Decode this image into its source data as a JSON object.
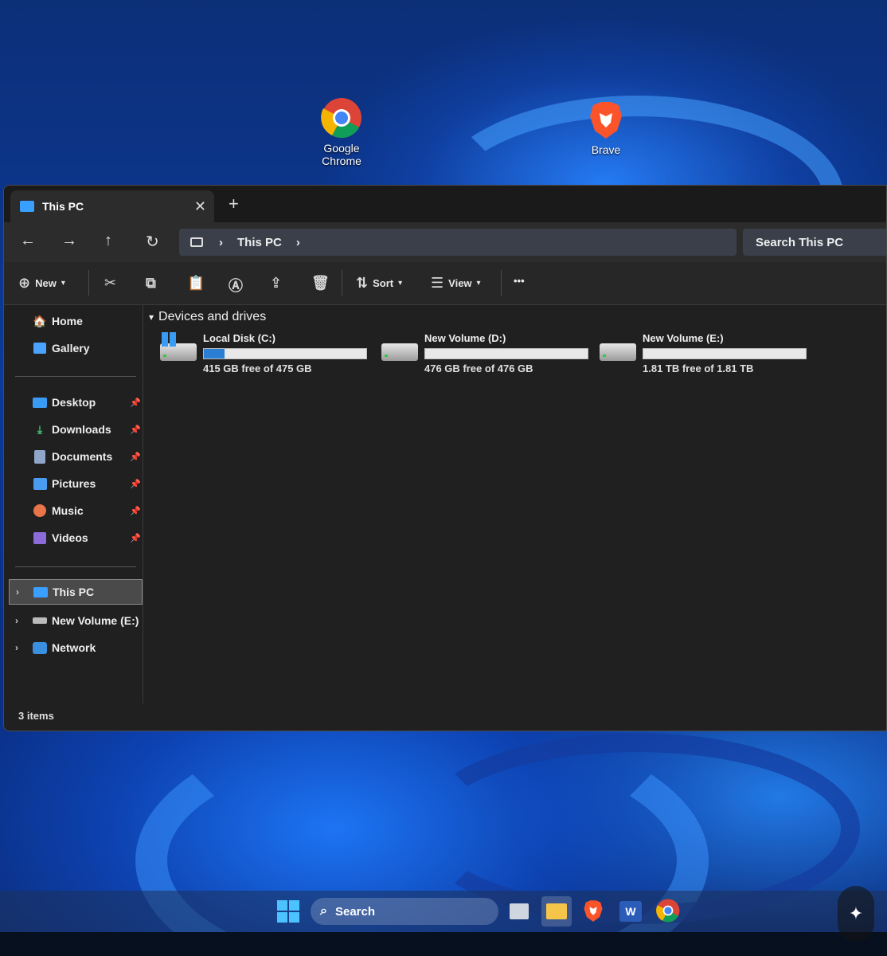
{
  "desktop": {
    "icons": [
      {
        "label": "Google Chrome",
        "icon": "chrome-icon"
      },
      {
        "label": "Brave",
        "icon": "brave-icon"
      }
    ]
  },
  "window": {
    "tab_title": "This PC",
    "tab_close": "✕",
    "new_tab": "+",
    "nav": {
      "back": "←",
      "forward": "→",
      "up": "↑",
      "refresh": "↻"
    },
    "breadcrumb": {
      "location": "This PC",
      "sep": "›"
    },
    "search_placeholder": "Search This PC",
    "toolbar": {
      "new_label": "New",
      "sort_label": "Sort",
      "view_label": "View",
      "more_label": "•••"
    },
    "sidebar": {
      "quick": [
        {
          "label": "Home",
          "icon": "home-icon"
        },
        {
          "label": "Gallery",
          "icon": "gallery-icon"
        }
      ],
      "pinned": [
        {
          "label": "Desktop",
          "icon": "desktop-folder-icon"
        },
        {
          "label": "Downloads",
          "icon": "downloads-icon"
        },
        {
          "label": "Documents",
          "icon": "documents-icon"
        },
        {
          "label": "Pictures",
          "icon": "pictures-icon"
        },
        {
          "label": "Music",
          "icon": "music-icon"
        },
        {
          "label": "Videos",
          "icon": "videos-icon"
        }
      ],
      "tree": [
        {
          "label": "This PC",
          "icon": "this-pc-icon",
          "selected": true
        },
        {
          "label": "New Volume (E:)",
          "icon": "drive-icon"
        },
        {
          "label": "Network",
          "icon": "network-icon"
        }
      ]
    },
    "content": {
      "group_title": "Devices and drives",
      "drives": [
        {
          "name": "Local Disk (C:)",
          "free_text": "415 GB free of 475 GB",
          "used_fraction": 0.126,
          "bar_color": "#2a7fd4"
        },
        {
          "name": "New Volume (D:)",
          "free_text": "476 GB free of 476 GB",
          "used_fraction": 0.0,
          "bar_color": "#2a7fd4"
        },
        {
          "name": "New Volume (E:)",
          "free_text": "1.81 TB free of 1.81 TB",
          "used_fraction": 0.0,
          "bar_color": "#2a7fd4"
        }
      ]
    },
    "status": {
      "items": "3 items"
    }
  },
  "taskbar": {
    "search_label": "Search",
    "apps": [
      "start-icon",
      "task-view-icon",
      "file-explorer-icon",
      "brave-icon",
      "word-icon",
      "chrome-icon"
    ]
  },
  "colors": {
    "accent": "#2a7fd4",
    "window_bg": "#202020"
  }
}
